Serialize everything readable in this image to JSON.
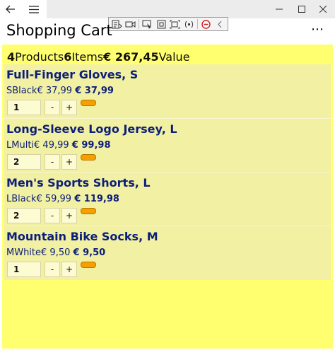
{
  "window": {
    "back_icon": "arrow-left-icon",
    "menu_icon": "hamburger-icon"
  },
  "debug_toolbar": {
    "icons": [
      "live-tree-icon",
      "record-icon",
      "select-element-icon",
      "layout-bounds-icon",
      "track-focus-icon",
      "binding-icon",
      "stop-icon",
      "collapse-icon"
    ]
  },
  "page": {
    "title": "Shopping Cart",
    "more_label": "⋯"
  },
  "summary": {
    "products_count": "4",
    "products_label": "Products",
    "items_count": "6",
    "items_label": "Items",
    "value_amount": "€ 267,45",
    "value_label": "Value"
  },
  "items": [
    {
      "name": "Full-Finger Gloves, S",
      "size": "S",
      "color": "Black",
      "unit_price": "€ 37,99",
      "line_total": "€ 37,99",
      "quantity": "1",
      "minus": "-",
      "plus": "+"
    },
    {
      "name": "Long-Sleeve Logo Jersey, L",
      "size": "L",
      "color": "Multi",
      "unit_price": "€ 49,99",
      "line_total": "€ 99,98",
      "quantity": "2",
      "minus": "-",
      "plus": "+"
    },
    {
      "name": "Men's Sports Shorts, L",
      "size": "L",
      "color": "Black",
      "unit_price": "€ 59,99",
      "line_total": "€ 119,98",
      "quantity": "2",
      "minus": "-",
      "plus": "+"
    },
    {
      "name": "Mountain Bike Socks, M",
      "size": "M",
      "color": "White",
      "unit_price": "€ 9,50",
      "line_total": "€ 9,50",
      "quantity": "1",
      "minus": "-",
      "plus": "+"
    }
  ],
  "colors": {
    "cart_background": "#ffff70",
    "list_background": "#f2f0a2",
    "item_text": "#0b1e7a",
    "badge": "#f5a000"
  }
}
